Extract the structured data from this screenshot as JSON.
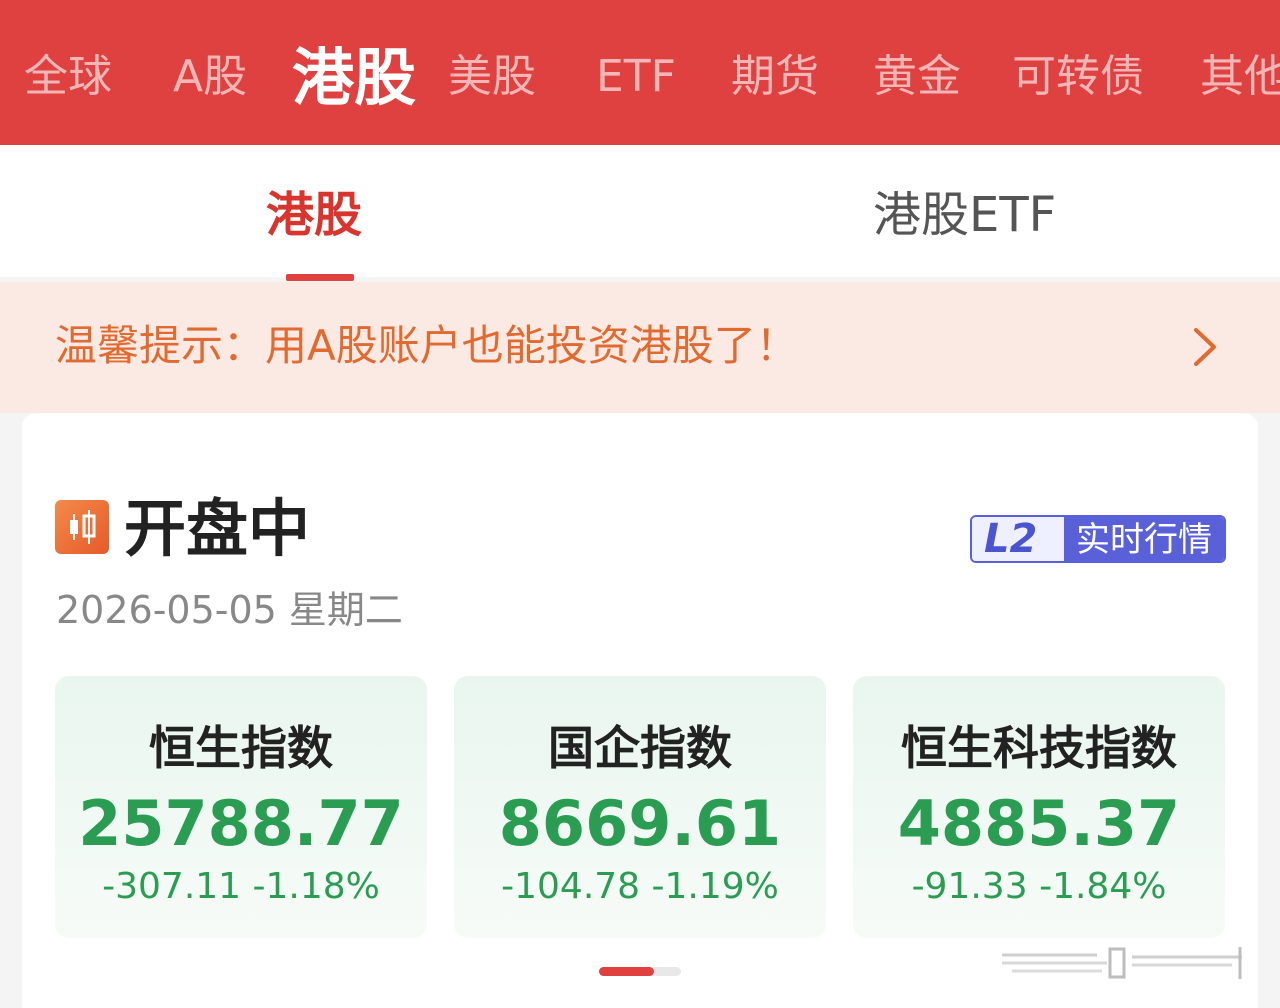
{
  "top_nav": {
    "items": [
      "全球",
      "A股",
      "港股",
      "美股",
      "ETF",
      "期货",
      "黄金",
      "可转债",
      "其他"
    ],
    "active_index": 2
  },
  "sub_tabs": {
    "items": [
      "港股",
      "港股ETF"
    ],
    "active_index": 0
  },
  "notice": {
    "text": "温馨提示：用A股账户也能投资港股了！"
  },
  "market": {
    "status_icon": "candlestick-icon",
    "status": "开盘中",
    "date": "2026-05-05 星期二",
    "badge": {
      "code": "L2",
      "label": "实时行情"
    }
  },
  "indices": [
    {
      "name": "恒生指数",
      "value": "25788.77",
      "change": "-307.11",
      "change_pct": "-1.18%"
    },
    {
      "name": "国企指数",
      "value": "8669.61",
      "change": "-104.78",
      "change_pct": "-1.19%"
    },
    {
      "name": "恒生科技指数",
      "value": "4885.37",
      "change": "-91.33",
      "change_pct": "-1.84%"
    }
  ],
  "colors": {
    "brand_red": "#de4140",
    "index_down_green": "#2a9d53",
    "notice_orange": "#e06a30",
    "badge_blue": "#5a61d8"
  }
}
